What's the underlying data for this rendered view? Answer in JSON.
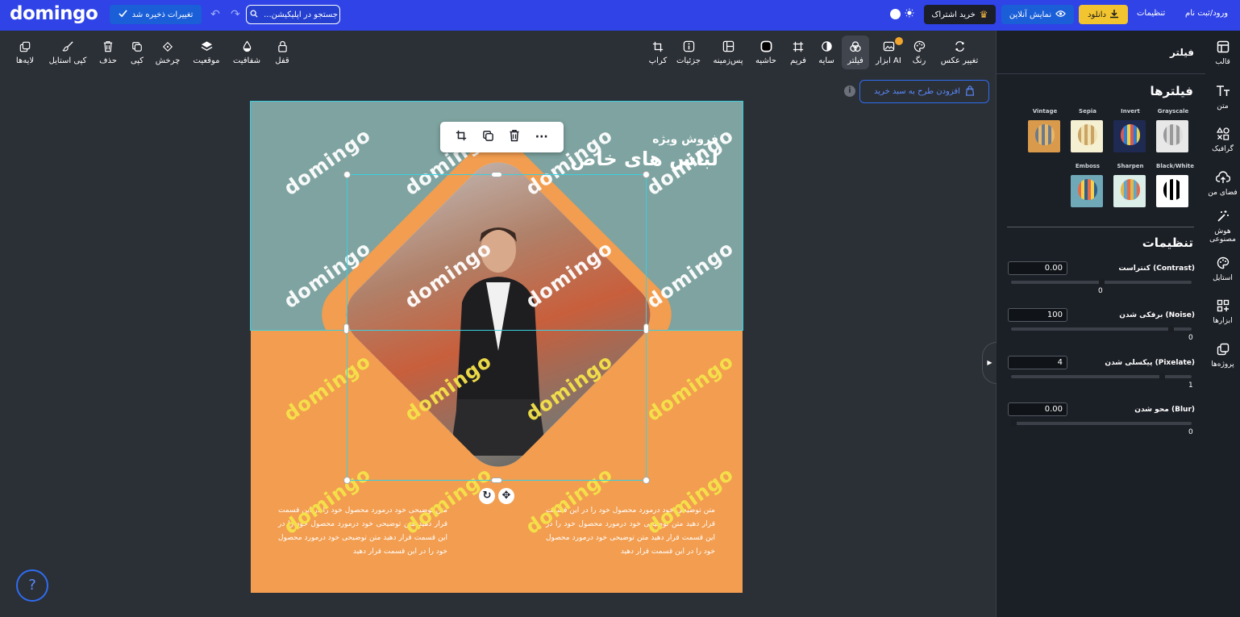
{
  "header": {
    "logo": "domingo",
    "save_label": "تغییرات ذخیره شد",
    "search_placeholder": "جستجو در اپلیکیشن...",
    "subscribe_label": "خرید اشتراک",
    "online_label": "نمایش آنلاین",
    "download_label": "دانلود",
    "settings_label": "تنظیمات",
    "login_label": "ورود/ثبت نام"
  },
  "toolbar": {
    "right_tools": [
      {
        "label": "تغییر عکس",
        "icon": "swap-icon"
      },
      {
        "label": "رنگ",
        "icon": "palette-icon"
      },
      {
        "label": "ابزار AI",
        "icon": "ai-image-icon"
      },
      {
        "label": "فیلتر",
        "icon": "filter-icon"
      },
      {
        "label": "سایه",
        "icon": "shadow-icon"
      },
      {
        "label": "فریم",
        "icon": "frame-icon"
      },
      {
        "label": "حاشیه",
        "icon": "border-icon"
      },
      {
        "label": "پس‌زمینه",
        "icon": "background-icon"
      },
      {
        "label": "جزئیات",
        "icon": "info-icon"
      },
      {
        "label": "کراپ",
        "icon": "crop-icon"
      }
    ],
    "left_tools": [
      {
        "label": "قفل",
        "icon": "lock-icon"
      },
      {
        "label": "شفافیت",
        "icon": "opacity-icon"
      },
      {
        "label": "موقعیت",
        "icon": "layers-icon"
      },
      {
        "label": "چرخش",
        "icon": "rotate-icon"
      },
      {
        "label": "کپی",
        "icon": "copy-icon"
      },
      {
        "label": "حذف",
        "icon": "trash-icon"
      },
      {
        "label": "کپی استایل",
        "icon": "brush-icon"
      },
      {
        "label": "لایه‌ها",
        "icon": "layers-stack-icon"
      }
    ]
  },
  "canvas": {
    "cart_label": "افزودن طرح به سبد خرید",
    "headline_small": "فروش ویژه",
    "headline_big": "لباس های خاص",
    "body_text": "متن توضیحی خود درمورد محصول خود را در این قسمت قرار دهید متن توضیحی خود درمورد محصول خود را در این قسمت قرار دهید متن توضیحی خود درمورد محصول خود را در این قسمت قرار دهید",
    "watermark": "domingo"
  },
  "panel": {
    "title": "فیلتر",
    "filters_title": "فیلترها",
    "filters": [
      {
        "label": "Grayscale",
        "colors": [
          "#bdbdbd",
          "#e8e8e8"
        ]
      },
      {
        "label": "Invert",
        "colors": [
          "#2b3a6a",
          "#d15a5a"
        ]
      },
      {
        "label": "Sepia",
        "colors": [
          "#f3e9c4",
          "#d6b676"
        ]
      },
      {
        "label": "Vintage",
        "colors": [
          "#d99a4c",
          "#6b7b8c"
        ]
      },
      {
        "label": "Black/White",
        "colors": [
          "#ffffff",
          "#000000"
        ]
      },
      {
        "label": "Sharpen",
        "colors": [
          "#cfe6e0",
          "#e2b84a"
        ]
      },
      {
        "label": "Emboss",
        "colors": [
          "#6fa9b8",
          "#e36b4a"
        ]
      }
    ],
    "settings_title": "تنظیمات",
    "sliders": [
      {
        "name": "کنتراست (Contrast)",
        "value": "0.00",
        "min": "0",
        "level": 0.5
      },
      {
        "name": "برفکی شدن (Noise)",
        "value": "100",
        "min": "0",
        "level": 0.9
      },
      {
        "name": "پیکسلی شدن (Pixelate)",
        "value": "4",
        "min": "1",
        "level": 0.85
      },
      {
        "name": "محو شدن (Blur)",
        "value": "0.00",
        "min": "0",
        "level": 0.0
      }
    ]
  },
  "rnav": [
    {
      "label": "قالب",
      "icon": "template-icon"
    },
    {
      "label": "متن",
      "icon": "text-icon"
    },
    {
      "label": "گرافیک",
      "icon": "shapes-icon"
    },
    {
      "label": "فضای من",
      "icon": "upload-cloud-icon"
    },
    {
      "label": "هوش مصنوعی",
      "icon": "magic-wand-icon"
    },
    {
      "label": "استایل",
      "icon": "palette-icon"
    },
    {
      "label": "ابزارها",
      "icon": "apps-icon"
    },
    {
      "label": "پروژه‌ها",
      "icon": "projects-icon"
    }
  ],
  "colors": {
    "brand": "#2f43e6",
    "accent_yellow": "#f2c430",
    "design_orange": "#f29d4f",
    "design_teal": "#7ea3a0",
    "selection": "#3ad0e0"
  }
}
